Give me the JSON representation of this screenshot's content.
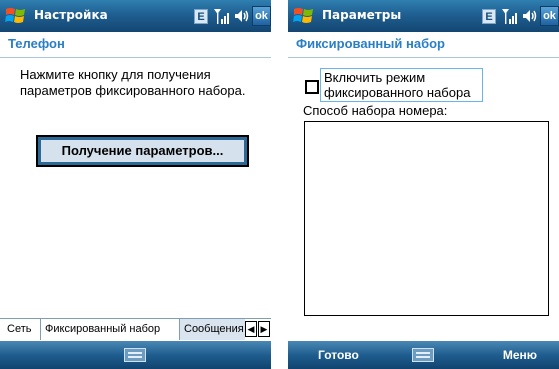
{
  "colors": {
    "titlebar": "#1f5f91",
    "section_title": "#2a7fc4",
    "button_border": "#2b6a97"
  },
  "icons": {
    "start": "windows-flag-icon",
    "signal": "signal-icon",
    "volume": "volume-icon",
    "keyboard": "keyboard-icon"
  },
  "left_screen": {
    "title": "Настройка",
    "indicator_e": "E",
    "ok_label": "ok",
    "section_title": "Телефон",
    "description": "Нажмите кнопку для получения параметров фиксированного набора.",
    "get_button": "Получение параметров...",
    "tabs": [
      "Сеть",
      "Фиксированный набор",
      "Сообщения"
    ],
    "tab_scroll_left": "◀",
    "tab_scroll_right": "▶"
  },
  "right_screen": {
    "title": "Параметры",
    "indicator_e": "E",
    "ok_label": "ok",
    "section_title": "Фиксированный набор",
    "checkbox_label": "Включить режим фиксированного набора",
    "checkbox_checked": false,
    "dial_method_label": "Способ набора номера:",
    "soft_left": "Готово",
    "soft_right": "Меню"
  }
}
